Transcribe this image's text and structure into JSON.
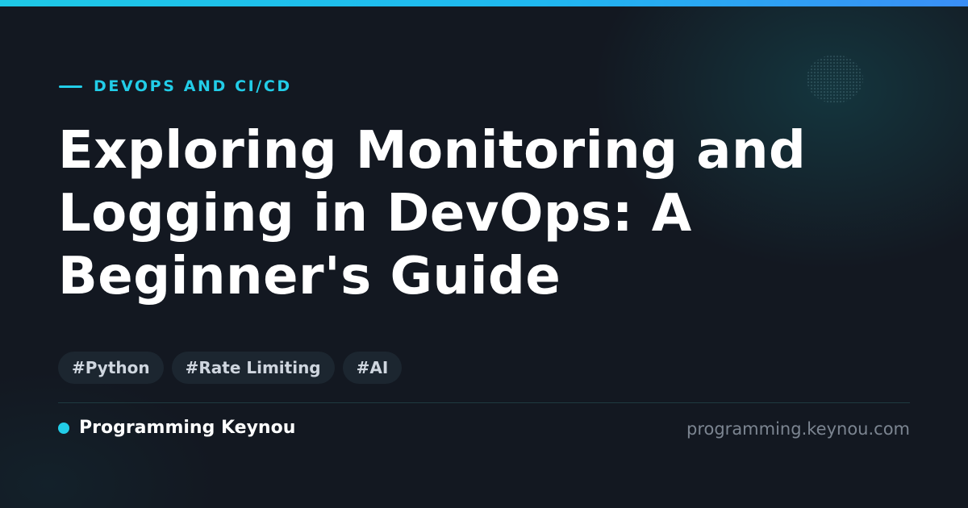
{
  "category": "DEVOPS AND CI/CD",
  "title": "Exploring Monitoring and Logging in DevOps: A Beginner's Guide",
  "tags": [
    "#Python",
    "#Rate Limiting",
    "#AI"
  ],
  "brand": {
    "name": "Programming Keynou",
    "url": "programming.keynou.com"
  },
  "colors": {
    "accent": "#22cde8",
    "background": "#131821",
    "tag_background": "#1c2630",
    "muted_text": "#7c8591"
  }
}
